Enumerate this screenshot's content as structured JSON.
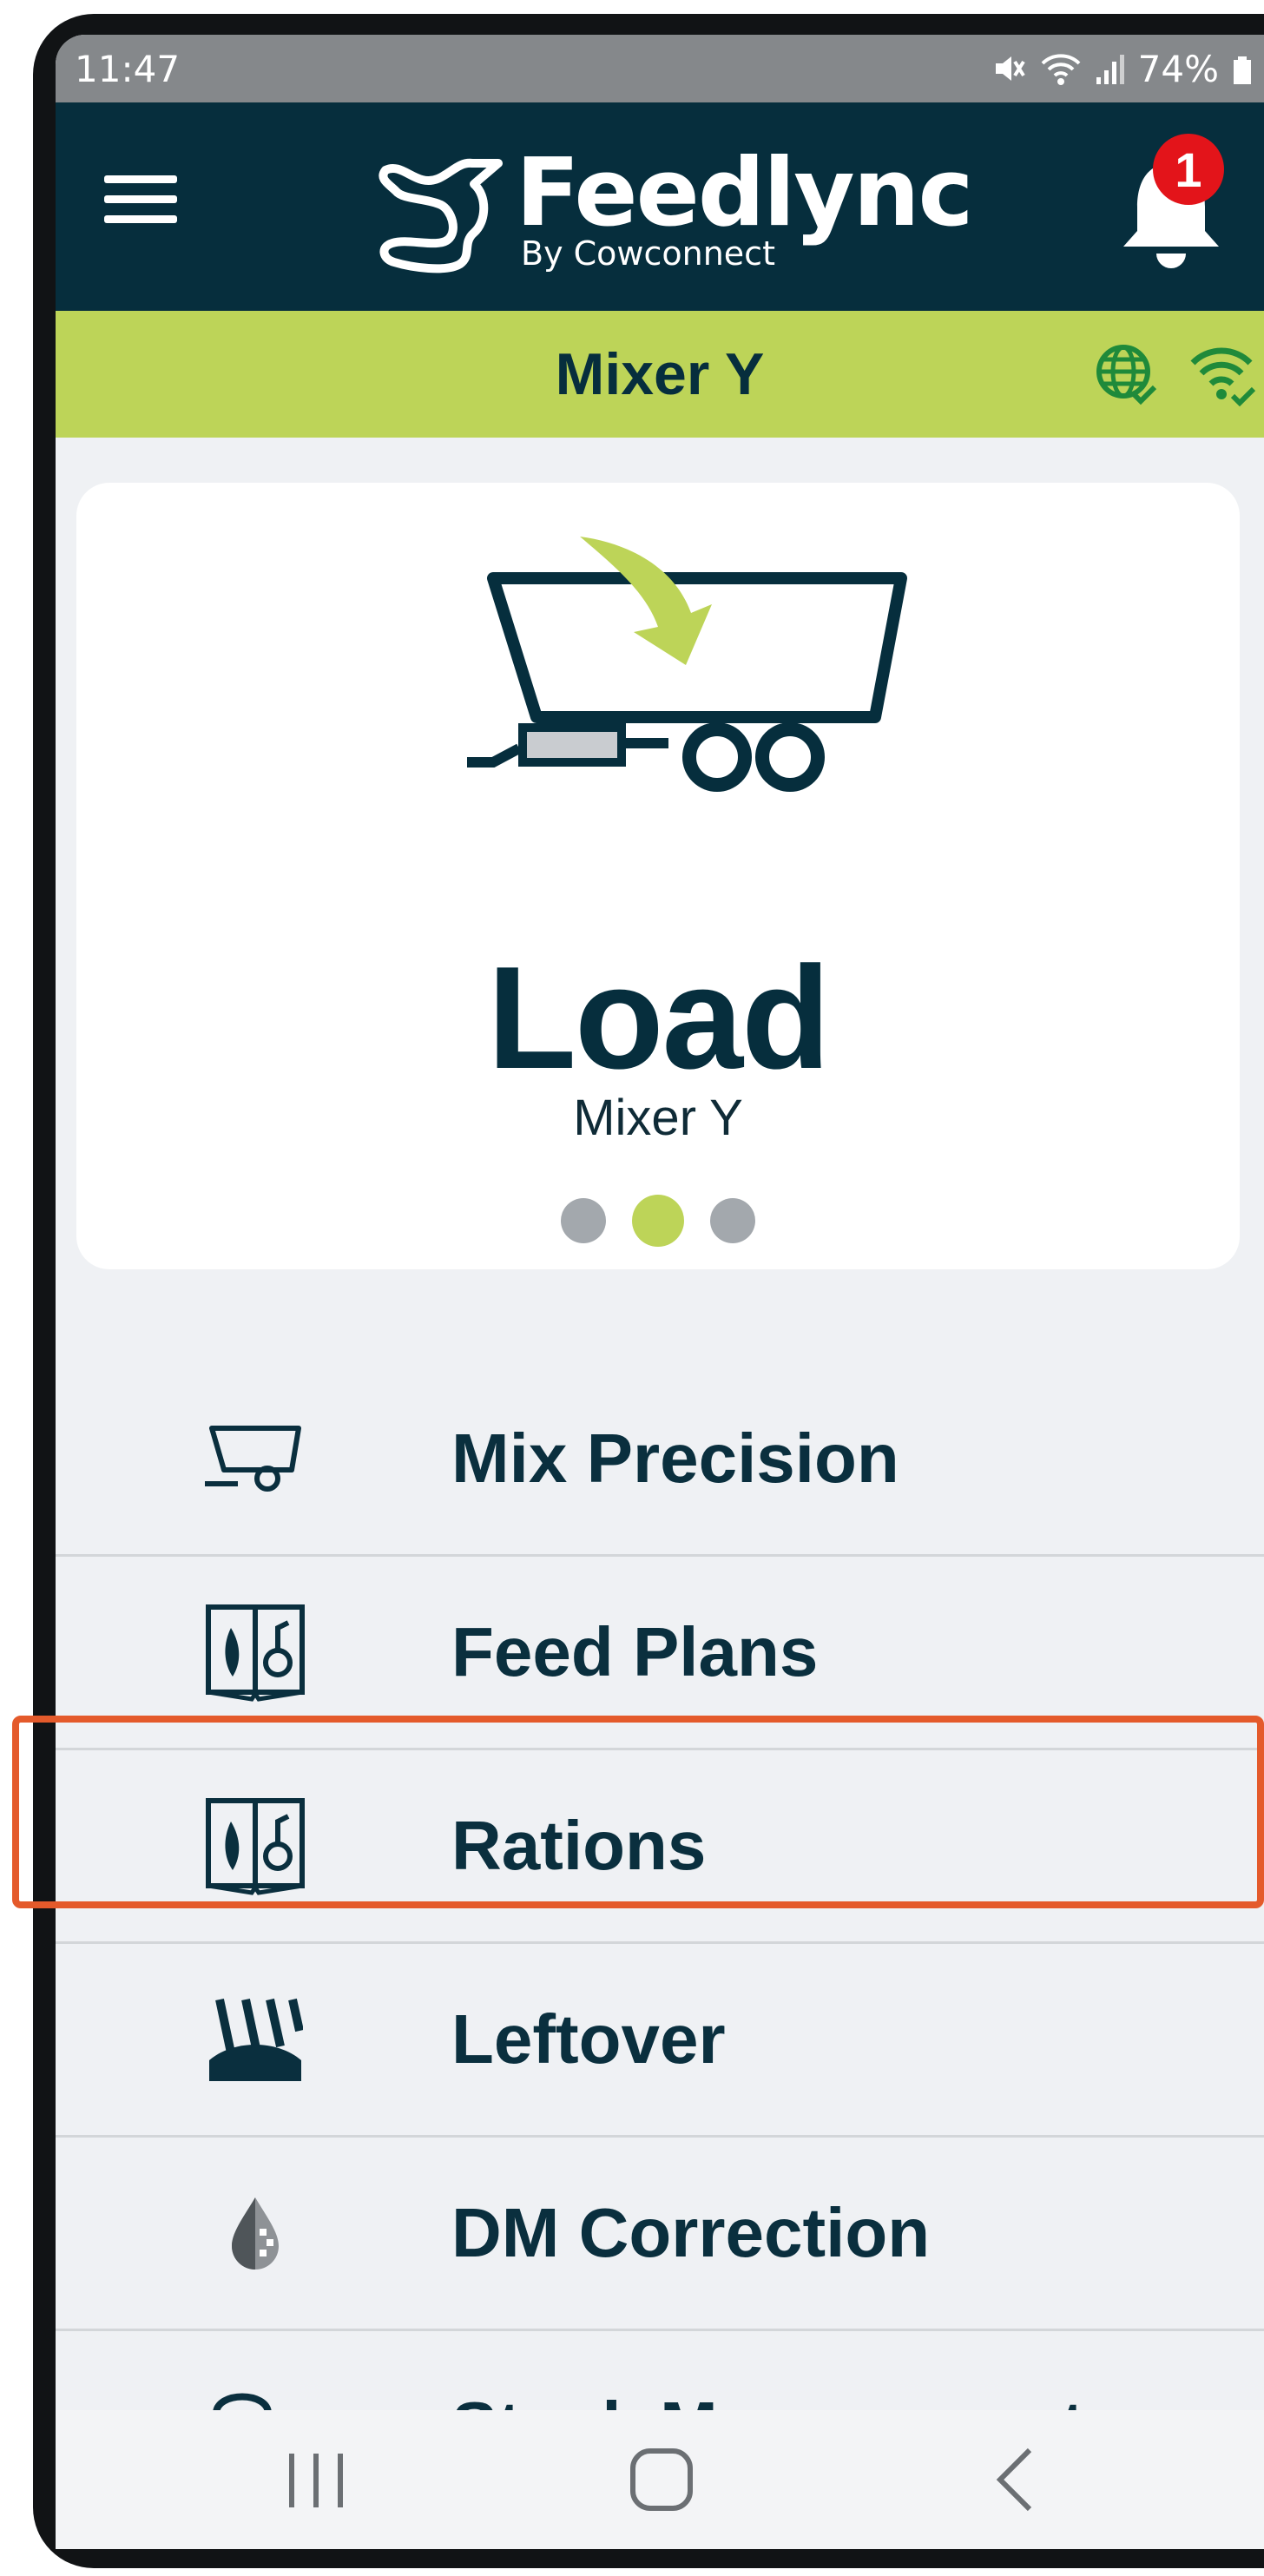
{
  "status_bar": {
    "time": "11:47",
    "battery": "74%"
  },
  "header": {
    "logo_title": "Feedlync",
    "logo_subtitle": "By Cowconnect",
    "notification_count": "1"
  },
  "mixer_bar": {
    "title": "Mixer Y"
  },
  "card": {
    "title": "Load",
    "subtitle": "Mixer Y",
    "pager": {
      "total": 3,
      "active": 2
    }
  },
  "menu": {
    "items": [
      {
        "label": "Mix Precision",
        "icon": "mixer-cart-icon"
      },
      {
        "label": "Feed Plans",
        "icon": "feed-book-icon"
      },
      {
        "label": "Rations",
        "icon": "feed-book-icon"
      },
      {
        "label": "Leftover",
        "icon": "leftover-icon"
      },
      {
        "label": "DM Correction",
        "icon": "drop-icon"
      },
      {
        "label": "Stock Management",
        "icon": "silo-icon"
      }
    ]
  },
  "colors": {
    "header_bg": "#062e3d",
    "accent_green": "#bdd458",
    "highlight": "#e45a2b",
    "badge": "#e3141a"
  }
}
